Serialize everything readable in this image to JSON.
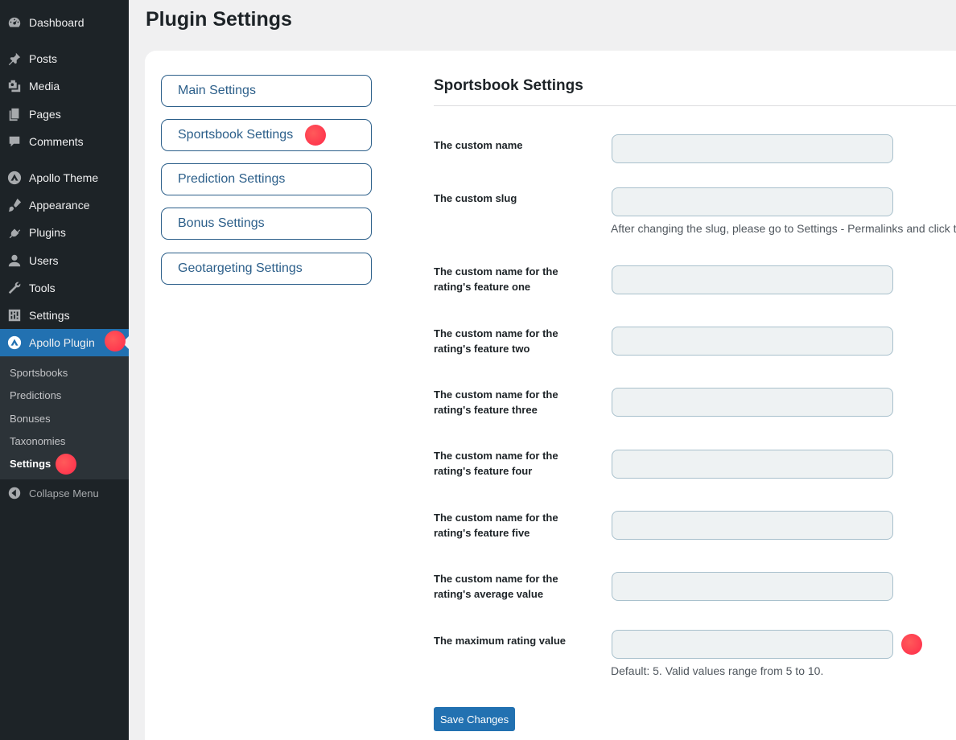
{
  "sidebar": {
    "menu": [
      {
        "label": "Dashboard",
        "icon": "dashboard-icon"
      },
      {
        "label": "Posts",
        "icon": "pin-icon"
      },
      {
        "label": "Media",
        "icon": "media-icon"
      },
      {
        "label": "Pages",
        "icon": "pages-icon"
      },
      {
        "label": "Comments",
        "icon": "comment-icon"
      },
      {
        "label": "Apollo Theme",
        "icon": "apollo-logo-icon"
      },
      {
        "label": "Appearance",
        "icon": "brush-icon"
      },
      {
        "label": "Plugins",
        "icon": "plug-icon"
      },
      {
        "label": "Users",
        "icon": "user-icon"
      },
      {
        "label": "Tools",
        "icon": "wrench-icon"
      },
      {
        "label": "Settings",
        "icon": "sliders-icon"
      },
      {
        "label": "Apollo Plugin",
        "icon": "apollo-logo-icon",
        "active": true
      }
    ],
    "submenu": [
      "Sportsbooks",
      "Predictions",
      "Bonuses",
      "Taxonomies",
      "Settings"
    ],
    "submenu_current": "Settings",
    "collapse_label": "Collapse Menu"
  },
  "page": {
    "title": "Plugin Settings"
  },
  "tabs": [
    "Main Settings",
    "Sportsbook Settings",
    "Prediction Settings",
    "Bonus Settings",
    "Geotargeting Settings"
  ],
  "section": {
    "title": "Sportsbook Settings",
    "fields": [
      {
        "label": "The custom name",
        "value": ""
      },
      {
        "label": "The custom slug",
        "value": "",
        "help": "After changing the slug, please go to Settings - Permalinks and click th"
      },
      {
        "label": "The custom name for the rating's feature one",
        "value": ""
      },
      {
        "label": "The custom name for the rating's feature two",
        "value": ""
      },
      {
        "label": "The custom name for the rating's feature three",
        "value": ""
      },
      {
        "label": "The custom name for the rating's feature four",
        "value": ""
      },
      {
        "label": "The custom name for the rating's feature five",
        "value": ""
      },
      {
        "label": "The custom name for the rating's average value",
        "value": ""
      },
      {
        "label": "The maximum rating value",
        "value": "",
        "help": "Default: 5. Valid values range from 5 to 10."
      }
    ],
    "save_label": "Save Changes"
  },
  "colors": {
    "sidebar_bg": "#1d2327",
    "accent": "#2271b1",
    "highlight_dot": "#ff3b4f"
  }
}
